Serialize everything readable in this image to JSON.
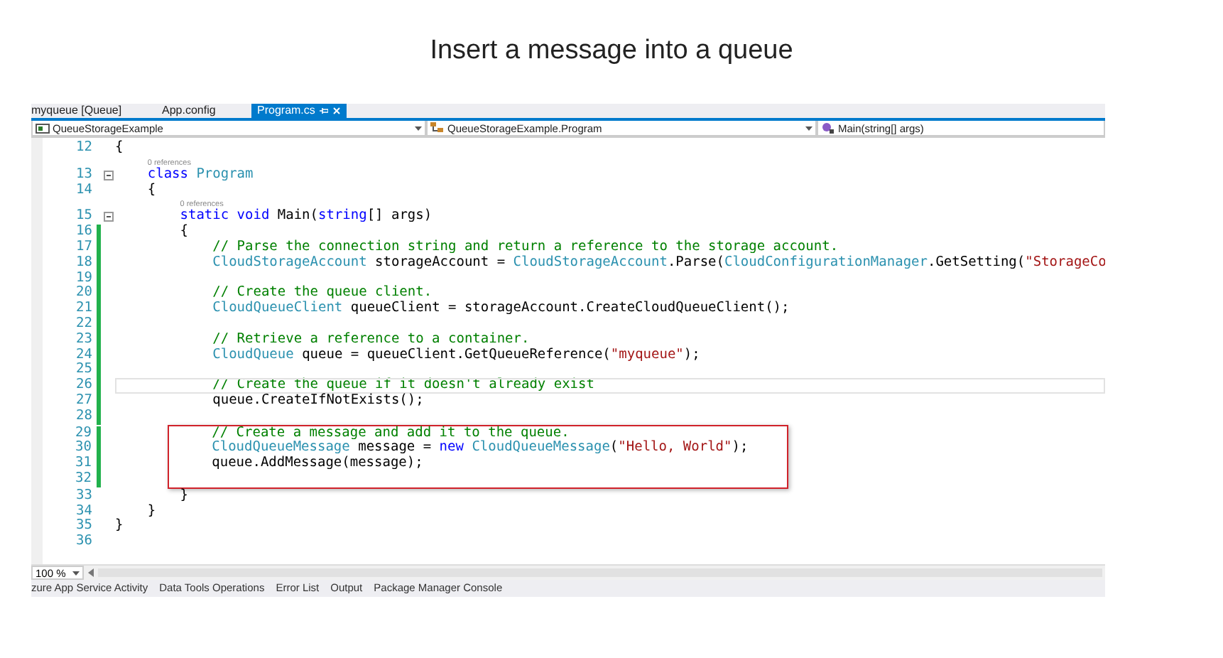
{
  "slide_title": "Insert a message into a queue",
  "document_tabs": [
    {
      "label": "myqueue [Queue]",
      "selected": false
    },
    {
      "label": "App.config",
      "selected": false
    },
    {
      "label": "Program.cs",
      "selected": true
    }
  ],
  "navigation_bar": [
    {
      "label": "QueueStorageExample"
    },
    {
      "label": "QueueStorageExample.Program"
    },
    {
      "label": "Main(string[] args)"
    }
  ],
  "editor": {
    "lines": [
      {
        "number": "12",
        "changed": false,
        "tokens": [
          {
            "kind": "plain",
            "text": "{"
          }
        ]
      },
      {
        "number": "13",
        "changed": false,
        "fold": true,
        "lens": "0 references",
        "tokens": [
          {
            "kind": "keyword",
            "text": "    class "
          },
          {
            "kind": "type",
            "text": "Program"
          }
        ]
      },
      {
        "number": "14",
        "changed": false,
        "tokens": [
          {
            "kind": "plain",
            "text": "    {"
          }
        ]
      },
      {
        "number": "15",
        "changed": false,
        "fold": true,
        "lens": "0 references",
        "tokens": [
          {
            "kind": "keyword",
            "text": "        static void"
          },
          {
            "kind": "plain",
            "text": " Main("
          },
          {
            "kind": "keyword",
            "text": "string"
          },
          {
            "kind": "plain",
            "text": "[] args)"
          }
        ]
      },
      {
        "number": "16",
        "changed": true,
        "tokens": [
          {
            "kind": "plain",
            "text": "        {"
          }
        ]
      },
      {
        "number": "17",
        "changed": true,
        "tokens": [
          {
            "kind": "comment",
            "text": "            // Parse the connection string and return a reference to the storage account."
          }
        ]
      },
      {
        "number": "18",
        "changed": true,
        "tokens": [
          {
            "kind": "type",
            "text": "            CloudStorageAccount"
          },
          {
            "kind": "plain",
            "text": " storageAccount = "
          },
          {
            "kind": "type",
            "text": "CloudStorageAccount"
          },
          {
            "kind": "plain",
            "text": ".Parse("
          },
          {
            "kind": "type",
            "text": "CloudConfigurationManager"
          },
          {
            "kind": "plain",
            "text": ".GetSetting("
          },
          {
            "kind": "string",
            "text": "\"StorageCo"
          }
        ]
      },
      {
        "number": "19",
        "changed": true
      },
      {
        "number": "20",
        "changed": true,
        "tokens": [
          {
            "kind": "comment",
            "text": "            // Create the queue client."
          }
        ]
      },
      {
        "number": "21",
        "changed": true,
        "tokens": [
          {
            "kind": "type",
            "text": "            CloudQueueClient"
          },
          {
            "kind": "plain",
            "text": " queueClient = storageAccount.CreateCloudQueueClient();"
          }
        ]
      },
      {
        "number": "22",
        "changed": true
      },
      {
        "number": "23",
        "changed": true,
        "tokens": [
          {
            "kind": "comment",
            "text": "            // Retrieve a reference to a container."
          }
        ]
      },
      {
        "number": "24",
        "changed": true,
        "tokens": [
          {
            "kind": "type",
            "text": "            CloudQueue"
          },
          {
            "kind": "plain",
            "text": " queue = queueClient.GetQueueReference("
          },
          {
            "kind": "string",
            "text": "\"myqueue\""
          },
          {
            "kind": "plain",
            "text": ");"
          }
        ]
      },
      {
        "number": "25",
        "changed": true
      },
      {
        "number": "26",
        "changed": true,
        "current": true,
        "tokens": [
          {
            "kind": "comment",
            "text": "            // Create the queue if it doesn't already exist"
          }
        ]
      },
      {
        "number": "27",
        "changed": true,
        "tokens": [
          {
            "kind": "plain",
            "text": "            queue.CreateIfNotExists();"
          }
        ]
      },
      {
        "number": "28",
        "changed": true
      },
      {
        "number": "29",
        "changed": true,
        "boxed": true,
        "tokens": [
          {
            "kind": "comment",
            "text": "            // Create a message and add it to the queue."
          }
        ]
      },
      {
        "number": "30",
        "changed": true,
        "boxed": true,
        "tokens": [
          {
            "kind": "type",
            "text": "            CloudQueueMessage"
          },
          {
            "kind": "plain",
            "text": " message = "
          },
          {
            "kind": "keyword",
            "text": "new "
          },
          {
            "kind": "type",
            "text": "CloudQueueMessage"
          },
          {
            "kind": "plain",
            "text": "("
          },
          {
            "kind": "string",
            "text": "\"Hello, World\""
          },
          {
            "kind": "plain",
            "text": ");"
          }
        ]
      },
      {
        "number": "31",
        "changed": true,
        "boxed": true,
        "tokens": [
          {
            "kind": "plain",
            "text": "            queue.AddMessage(message);"
          }
        ]
      },
      {
        "number": "32",
        "changed": true,
        "boxed": true
      },
      {
        "number": "33",
        "changed": false,
        "tokens": [
          {
            "kind": "plain",
            "text": "        }"
          }
        ]
      },
      {
        "number": "34",
        "changed": false,
        "tokens": [
          {
            "kind": "plain",
            "text": "    }"
          }
        ]
      },
      {
        "number": "35",
        "changed": false,
        "tokens": [
          {
            "kind": "plain",
            "text": "}"
          }
        ]
      },
      {
        "number": "36",
        "changed": false
      }
    ]
  },
  "zoom": "100 %",
  "tool_tabs": [
    "zure App Service Activity",
    "Data Tools Operations",
    "Error List",
    "Output",
    "Package Manager Console"
  ]
}
